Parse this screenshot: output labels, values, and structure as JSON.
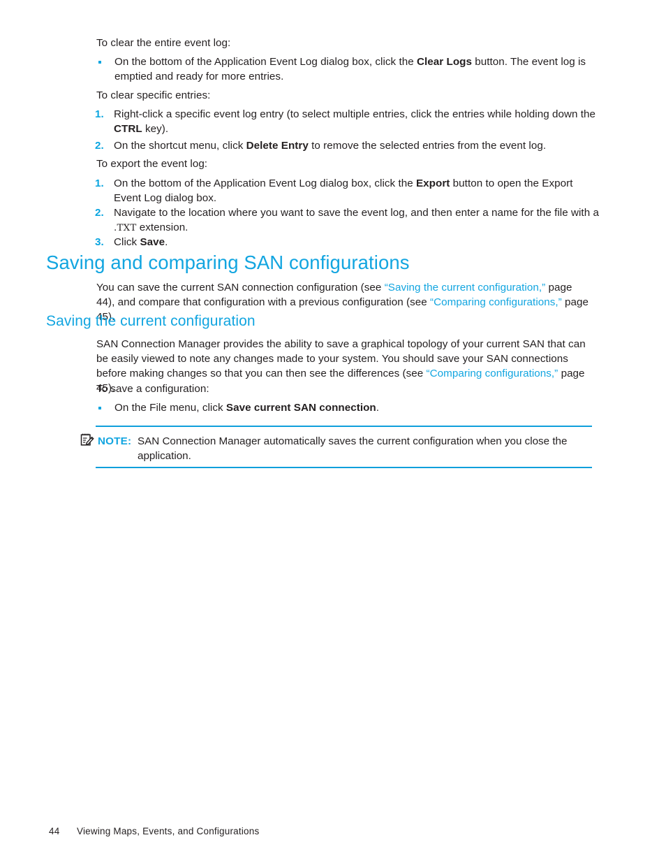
{
  "colors": {
    "accent": "#12a5e0",
    "body_text": "#231f20",
    "rule": "#0f9fdb"
  },
  "sections": {
    "clear_entire": {
      "lead": "To clear the entire event log:",
      "bullet": {
        "pre": "On the bottom of the Application Event Log dialog box, click the ",
        "bold": "Clear Logs",
        "post": " button. The event log is emptied and ready for more entries."
      }
    },
    "clear_specific": {
      "lead": "To clear specific entries:",
      "steps": [
        {
          "num": "1.",
          "pre": "Right-click a specific event log entry (to select multiple entries, click the entries while holding down the ",
          "bold": "CTRL",
          "post": " key)."
        },
        {
          "num": "2.",
          "pre": "On the shortcut menu, click ",
          "bold": "Delete Entry",
          "post": " to remove the selected entries from the event log."
        }
      ]
    },
    "export": {
      "lead": "To export the event log:",
      "steps": [
        {
          "num": "1.",
          "pre": "On the bottom of the Application Event Log dialog box, click the ",
          "bold": "Export",
          "post": " button to open the Export Event Log dialog box."
        },
        {
          "num": "2.",
          "pre": "Navigate to the location where you want to save the event log, and then enter a name for the file with a ",
          "mono": ".TXT",
          "post": " extension."
        },
        {
          "num": "3.",
          "pre": "Click ",
          "bold": "Save",
          "post": "."
        }
      ]
    },
    "saving_comparing": {
      "heading": "Saving and comparing SAN configurations",
      "paragraph": {
        "p1": "You can save the current SAN connection configuration (see ",
        "link1": "“Saving the current configuration,”",
        "p2": " page 44), and compare that configuration with a previous configuration (see ",
        "link2": "“Comparing configurations,”",
        "p3": " page 45)."
      }
    },
    "saving_current": {
      "heading": "Saving the current configuration",
      "paragraph": {
        "p1": "SAN Connection Manager provides the ability to save a graphical topology of your current SAN that can be easily viewed to note any changes made to your system. You should save your SAN connections before making changes so that you can then see the differences (see ",
        "link1": "“Comparing configurations,”",
        "p2": " page 45)."
      },
      "lead": "To save a configuration:",
      "bullet": {
        "pre": "On the File menu, click ",
        "bold": "Save current SAN connection",
        "post": "."
      }
    },
    "note": {
      "icon": "note-pencil-icon",
      "label": "NOTE:",
      "text": "SAN Connection Manager automatically saves the current configuration when you close the application."
    }
  },
  "footer": {
    "page_number": "44",
    "chapter_title": "Viewing Maps, Events, and Configurations"
  }
}
